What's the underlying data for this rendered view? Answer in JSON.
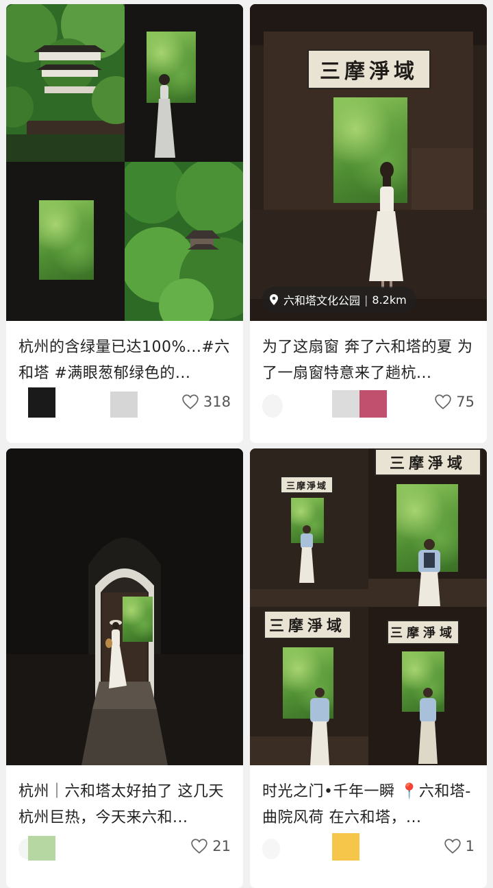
{
  "feed": {
    "cards": [
      {
        "title": "杭州的含绿量已达100%...#六和塔 #满眼葱郁绿色的...",
        "likes": "318",
        "image_desc": "collage-forest-window"
      },
      {
        "title": "为了这扇窗 奔了六和塔的夏 为了一扇窗特意来了趟杭...",
        "likes": "75",
        "location": "六和塔文化公园",
        "distance": "8.2km",
        "plaque_text": "三摩淨域"
      },
      {
        "title": "杭州｜六和塔太好拍了 这几天杭州巨热，今天来六和...",
        "likes": "21"
      },
      {
        "title": "时光之门•千年一瞬 📍六和塔-曲院风荷 在六和塔，...",
        "likes": "1",
        "plaque_text": "三摩淨域"
      }
    ]
  },
  "icons": {
    "like": "heart-outline-icon",
    "location": "location-pin-icon"
  },
  "colors": {
    "background": "#f1f1f1",
    "card": "#ffffff",
    "text": "#222222",
    "muted": "#555555"
  }
}
